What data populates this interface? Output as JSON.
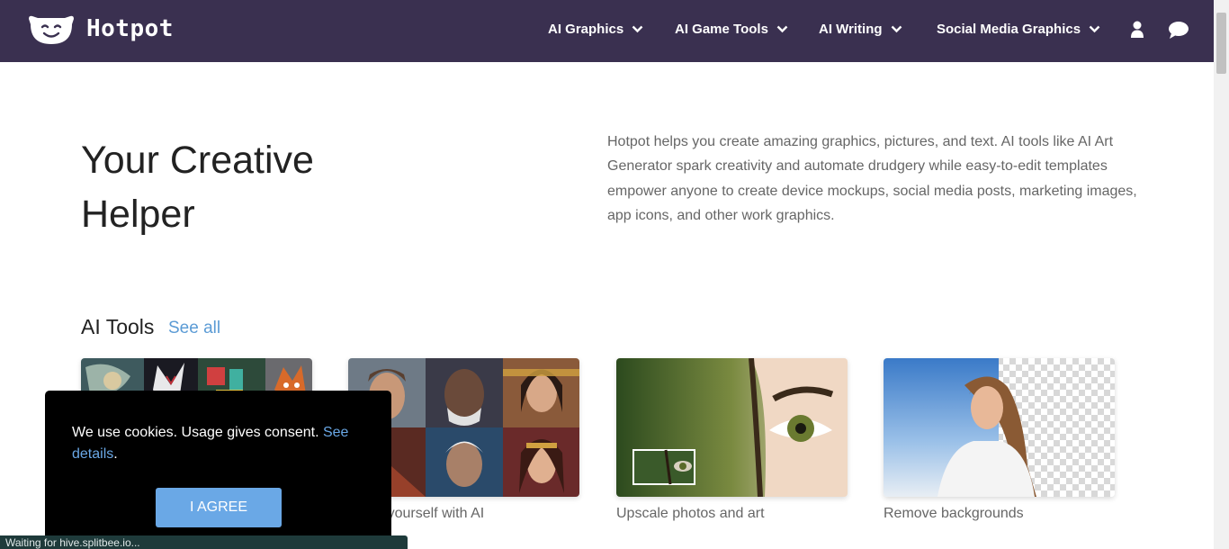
{
  "brand": {
    "name": "Hotpot"
  },
  "nav": {
    "items": [
      {
        "label": "AI Graphics"
      },
      {
        "label": "AI Game Tools"
      },
      {
        "label": "AI Writing"
      },
      {
        "label": "Social Media Graphics"
      }
    ],
    "icons": [
      "user-icon",
      "chat-icon"
    ]
  },
  "hero": {
    "title": "Your Creative Helper",
    "description": "Hotpot helps you create amazing graphics, pictures, and text. AI tools like AI Art Generator spark creativity and automate drudgery while easy-to-edit templates empower anyone to create device mockups, social media posts, marketing images, app icons, and other work graphics."
  },
  "tools": {
    "title": "AI Tools",
    "see_all": "See all",
    "cards": [
      {
        "label": ""
      },
      {
        "label": "agine yourself with AI"
      },
      {
        "label": "Upscale photos and art"
      },
      {
        "label": "Remove backgrounds"
      }
    ]
  },
  "cookie": {
    "text": "We use cookies. Usage gives consent.",
    "link": "See details",
    "suffix": ".",
    "button": "I AGREE"
  },
  "status_bar": "Waiting for hive.splitbee.io...",
  "colors": {
    "nav_bg": "#3a3050",
    "accent": "#6aa8e6",
    "link": "#5b9bd5"
  }
}
